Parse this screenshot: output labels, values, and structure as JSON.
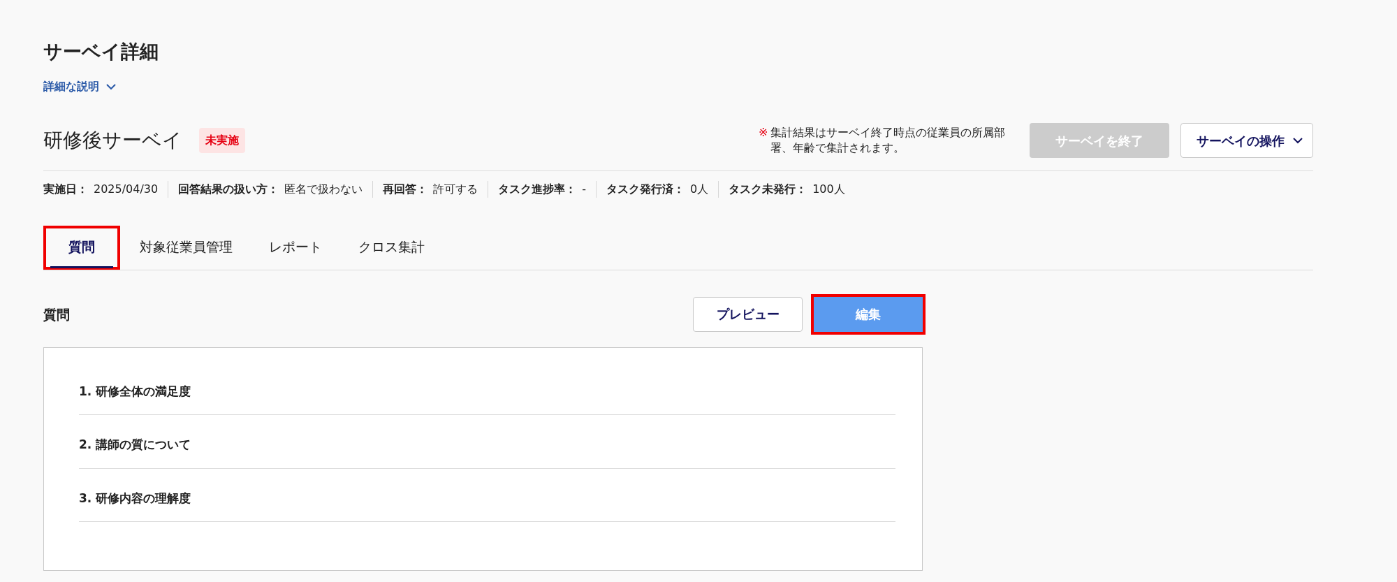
{
  "page": {
    "title": "サーベイ詳細",
    "description_toggle": {
      "label": "詳細な説明",
      "expanded": false
    }
  },
  "survey": {
    "name": "研修後サーベイ",
    "status": "未実施",
    "note": {
      "mark": "※",
      "text": "集計結果はサーベイ終了時点の従業員の所属部署、年齢で集計されます。"
    },
    "buttons": [
      {
        "label": "サーベイを終了",
        "kind": "end",
        "disabled": true
      },
      {
        "label": "サーベイの操作",
        "kind": "menu",
        "disabled": false
      }
    ]
  },
  "meta": [
    {
      "label": "実施日：",
      "value": "2025/04/30"
    },
    {
      "label": "回答結果の扱い方：",
      "value": "匿名で扱わない"
    },
    {
      "label": "再回答：",
      "value": "許可する"
    },
    {
      "label": "タスク進捗率：",
      "value": "-"
    },
    {
      "label": "タスク発行済：",
      "value": "0人"
    },
    {
      "label": "タスク未発行：",
      "value": "100人"
    }
  ],
  "tabs": [
    {
      "label": "質問",
      "selected": true,
      "highlighted": true
    },
    {
      "label": "対象従業員管理",
      "selected": false,
      "highlighted": false
    },
    {
      "label": "レポート",
      "selected": false,
      "highlighted": false
    },
    {
      "label": "クロス集計",
      "selected": false,
      "highlighted": false
    }
  ],
  "questions_section": {
    "title": "質問",
    "buttons": [
      {
        "label": "プレビュー",
        "kind": "outline",
        "highlighted": false
      },
      {
        "label": "編集",
        "kind": "primary",
        "highlighted": true
      }
    ],
    "questions": [
      "1. 研修全体の満足度",
      "2. 講師の質について",
      "3. 研修内容の理解度"
    ]
  }
}
